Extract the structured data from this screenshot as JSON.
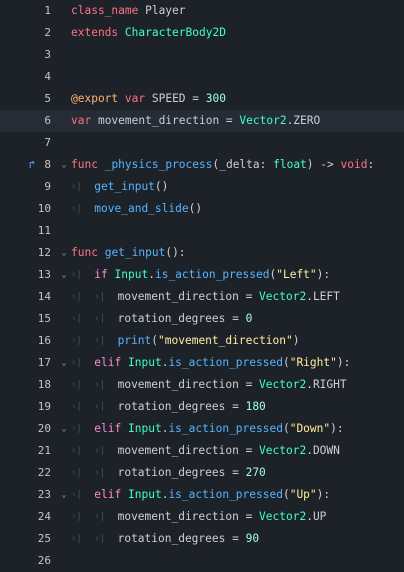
{
  "colors": {
    "background": "#1d2229",
    "current_line": "#262c35",
    "line_number": "#c2c4c8",
    "keyword": "#ff7085",
    "control_keyword": "#ff8ccc",
    "class_name": "#42ffc2",
    "function": "#57b3ff",
    "annotation": "#ffb373",
    "number": "#a1ffe0",
    "string": "#ffeda1",
    "text": "#cdcfd2",
    "tab_marker": "#4b525b",
    "override_marker": "#5aa6ff"
  },
  "editor": {
    "current_line": 6,
    "tab_glyph": "›|",
    "fold_glyph": "⌄",
    "override_glyph": "↱",
    "lines": [
      {
        "n": "1",
        "tokens": [
          {
            "t": "class_name",
            "c": "kw"
          },
          {
            "t": " Player",
            "c": "txt"
          }
        ]
      },
      {
        "n": "2",
        "tokens": [
          {
            "t": "extends",
            "c": "kw"
          },
          {
            "t": " ",
            "c": "txt"
          },
          {
            "t": "CharacterBody2D",
            "c": "cls"
          }
        ]
      },
      {
        "n": "3",
        "tokens": []
      },
      {
        "n": "4",
        "tokens": []
      },
      {
        "n": "5",
        "tokens": [
          {
            "t": "@export",
            "c": "ann"
          },
          {
            "t": " ",
            "c": "txt"
          },
          {
            "t": "var",
            "c": "kw"
          },
          {
            "t": " SPEED = ",
            "c": "txt"
          },
          {
            "t": "300",
            "c": "num"
          }
        ]
      },
      {
        "n": "6",
        "tokens": [
          {
            "t": "var",
            "c": "kw"
          },
          {
            "t": " movement_direction = ",
            "c": "txt"
          },
          {
            "t": "Vector2",
            "c": "cls"
          },
          {
            "t": ".ZERO",
            "c": "txt"
          }
        ]
      },
      {
        "n": "7",
        "tokens": []
      },
      {
        "n": "8",
        "override": true,
        "fold": true,
        "tokens": [
          {
            "t": "func",
            "c": "kw"
          },
          {
            "t": " ",
            "c": "txt"
          },
          {
            "t": "_physics_process",
            "c": "fn"
          },
          {
            "t": "(_delta: ",
            "c": "txt"
          },
          {
            "t": "float",
            "c": "cls"
          },
          {
            "t": ") -> ",
            "c": "txt"
          },
          {
            "t": "void",
            "c": "kw"
          },
          {
            "t": ":",
            "c": "txt"
          }
        ]
      },
      {
        "n": "9",
        "tabs": 1,
        "tokens": [
          {
            "t": "get_input",
            "c": "fn"
          },
          {
            "t": "()",
            "c": "txt"
          }
        ]
      },
      {
        "n": "10",
        "tabs": 1,
        "tokens": [
          {
            "t": "move_and_slide",
            "c": "fn"
          },
          {
            "t": "()",
            "c": "txt"
          }
        ]
      },
      {
        "n": "11",
        "tokens": []
      },
      {
        "n": "12",
        "fold": true,
        "tokens": [
          {
            "t": "func",
            "c": "kw"
          },
          {
            "t": " ",
            "c": "txt"
          },
          {
            "t": "get_input",
            "c": "fn"
          },
          {
            "t": "():",
            "c": "txt"
          }
        ]
      },
      {
        "n": "13",
        "fold": true,
        "tabs": 1,
        "tokens": [
          {
            "t": "if",
            "c": "kw2"
          },
          {
            "t": " ",
            "c": "txt"
          },
          {
            "t": "Input",
            "c": "cls"
          },
          {
            "t": ".",
            "c": "txt"
          },
          {
            "t": "is_action_pressed",
            "c": "fn"
          },
          {
            "t": "(",
            "c": "txt"
          },
          {
            "t": "\"Left\"",
            "c": "str"
          },
          {
            "t": "):",
            "c": "txt"
          }
        ]
      },
      {
        "n": "14",
        "tabs": 2,
        "tokens": [
          {
            "t": "movement_direction = ",
            "c": "txt"
          },
          {
            "t": "Vector2",
            "c": "cls"
          },
          {
            "t": ".LEFT",
            "c": "txt"
          }
        ]
      },
      {
        "n": "15",
        "tabs": 2,
        "tokens": [
          {
            "t": "rotation_degrees = ",
            "c": "txt"
          },
          {
            "t": "0",
            "c": "num"
          }
        ]
      },
      {
        "n": "16",
        "tabs": 2,
        "tokens": [
          {
            "t": "print",
            "c": "fn"
          },
          {
            "t": "(",
            "c": "txt"
          },
          {
            "t": "\"movement_direction\"",
            "c": "str"
          },
          {
            "t": ")",
            "c": "txt"
          }
        ]
      },
      {
        "n": "17",
        "fold": true,
        "tabs": 1,
        "tokens": [
          {
            "t": "elif",
            "c": "kw2"
          },
          {
            "t": " ",
            "c": "txt"
          },
          {
            "t": "Input",
            "c": "cls"
          },
          {
            "t": ".",
            "c": "txt"
          },
          {
            "t": "is_action_pressed",
            "c": "fn"
          },
          {
            "t": "(",
            "c": "txt"
          },
          {
            "t": "\"Right\"",
            "c": "str"
          },
          {
            "t": "):",
            "c": "txt"
          }
        ]
      },
      {
        "n": "18",
        "tabs": 2,
        "tokens": [
          {
            "t": "movement_direction = ",
            "c": "txt"
          },
          {
            "t": "Vector2",
            "c": "cls"
          },
          {
            "t": ".RIGHT",
            "c": "txt"
          }
        ]
      },
      {
        "n": "19",
        "tabs": 2,
        "tokens": [
          {
            "t": "rotation_degrees = ",
            "c": "txt"
          },
          {
            "t": "180",
            "c": "num"
          }
        ]
      },
      {
        "n": "20",
        "fold": true,
        "tabs": 1,
        "tokens": [
          {
            "t": "elif",
            "c": "kw2"
          },
          {
            "t": " ",
            "c": "txt"
          },
          {
            "t": "Input",
            "c": "cls"
          },
          {
            "t": ".",
            "c": "txt"
          },
          {
            "t": "is_action_pressed",
            "c": "fn"
          },
          {
            "t": "(",
            "c": "txt"
          },
          {
            "t": "\"Down\"",
            "c": "str"
          },
          {
            "t": "):",
            "c": "txt"
          }
        ]
      },
      {
        "n": "21",
        "tabs": 2,
        "tokens": [
          {
            "t": "movement_direction = ",
            "c": "txt"
          },
          {
            "t": "Vector2",
            "c": "cls"
          },
          {
            "t": ".DOWN",
            "c": "txt"
          }
        ]
      },
      {
        "n": "22",
        "tabs": 2,
        "tokens": [
          {
            "t": "rotation_degrees = ",
            "c": "txt"
          },
          {
            "t": "270",
            "c": "num"
          }
        ]
      },
      {
        "n": "23",
        "fold": true,
        "tabs": 1,
        "tokens": [
          {
            "t": "elif",
            "c": "kw2"
          },
          {
            "t": " ",
            "c": "txt"
          },
          {
            "t": "Input",
            "c": "cls"
          },
          {
            "t": ".",
            "c": "txt"
          },
          {
            "t": "is_action_pressed",
            "c": "fn"
          },
          {
            "t": "(",
            "c": "txt"
          },
          {
            "t": "\"Up\"",
            "c": "str"
          },
          {
            "t": "):",
            "c": "txt"
          }
        ]
      },
      {
        "n": "24",
        "tabs": 2,
        "tokens": [
          {
            "t": "movement_direction = ",
            "c": "txt"
          },
          {
            "t": "Vector2",
            "c": "cls"
          },
          {
            "t": ".UP",
            "c": "txt"
          }
        ]
      },
      {
        "n": "25",
        "tabs": 2,
        "tokens": [
          {
            "t": "rotation_degrees = ",
            "c": "txt"
          },
          {
            "t": "90",
            "c": "num"
          }
        ]
      },
      {
        "n": "26",
        "tokens": []
      }
    ]
  }
}
